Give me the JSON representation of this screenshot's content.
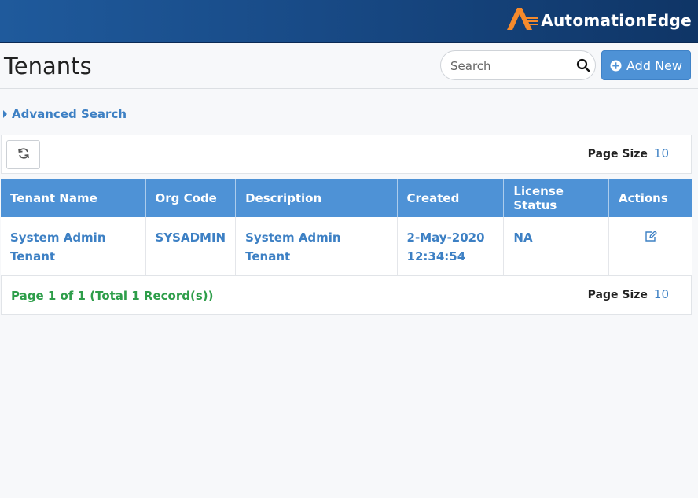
{
  "brand": {
    "name": "AutomationEdge",
    "logo_icon": "automationedge-logo-icon",
    "accent": "#f58a2c"
  },
  "header": {
    "title": "Tenants"
  },
  "search": {
    "placeholder": "Search",
    "icon": "search-icon"
  },
  "add_button": {
    "label": "Add New",
    "icon": "plus-circle-icon"
  },
  "advanced_search": {
    "label": "Advanced Search"
  },
  "toolbar": {
    "refresh_icon": "refresh-icon",
    "page_size_label": "Page Size",
    "page_size_value": "10"
  },
  "table": {
    "columns": [
      "Tenant Name",
      "Org Code",
      "Description",
      "Created",
      "License Status",
      "Actions"
    ],
    "rows": [
      {
        "tenant_name": "System Admin Tenant",
        "org_code": "SYSADMIN",
        "description": "System Admin Tenant",
        "created_date": "2-May-2020",
        "created_time": "12:34:54",
        "license_status": "NA",
        "action_icon": "edit-icon"
      }
    ]
  },
  "footer": {
    "paging_text": "Page 1 of 1 (Total 1 Record(s))",
    "page_size_label": "Page Size",
    "page_size_value": "10"
  },
  "colors": {
    "header_blue": "#4e92d6",
    "link_blue": "#3d80c4",
    "paging_green": "#2e9e4a"
  }
}
